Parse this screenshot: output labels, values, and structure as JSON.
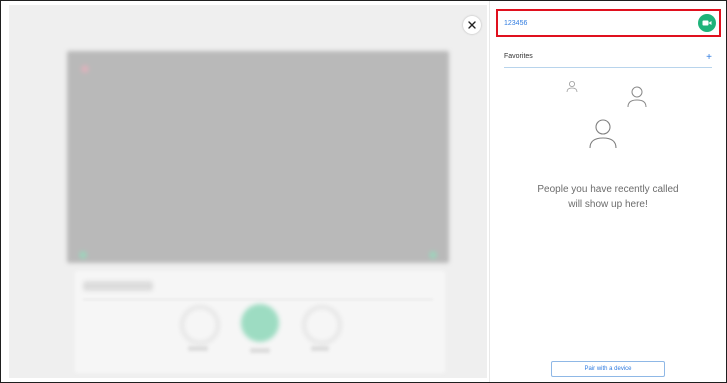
{
  "dialer": {
    "number_value": "123456",
    "call_icon": "call-icon",
    "favorites_label": "Favorites",
    "add_favorite_label": "+",
    "empty_message_line1": "People you have recently called",
    "empty_message_line2": "will show up here!",
    "pair_button_label": "Pair with a device"
  },
  "close_icon": "close-icon",
  "colors": {
    "accent_green": "#1fb37a",
    "link_blue": "#2f7be0",
    "highlight_red": "#e0101e",
    "backdrop_gray": "#efefef"
  }
}
